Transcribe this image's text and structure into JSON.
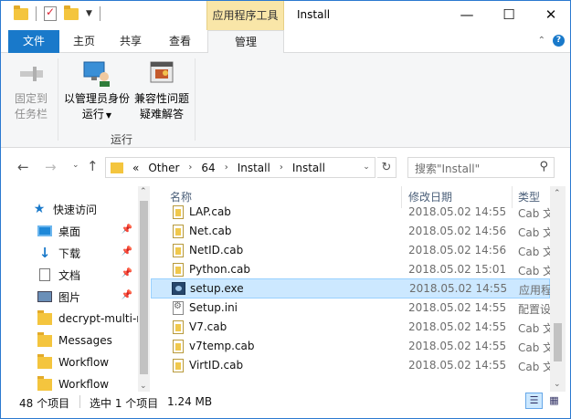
{
  "titlebar": {
    "context_tab_header": "应用程序工具",
    "window_title": "Install",
    "minimize": "—",
    "maximize": "☐",
    "close": "✕"
  },
  "ribbon_tabs": {
    "file": "文件",
    "home": "主页",
    "share": "共享",
    "view": "查看",
    "manage": "管理"
  },
  "ribbon": {
    "pin_line1": "固定到",
    "pin_line2": "任务栏",
    "runas_line1": "以管理员身份",
    "runas_line2": "运行",
    "compat_line1": "兼容性问题",
    "compat_line2": "疑难解答",
    "group_label": "运行"
  },
  "address": {
    "overflow": "«",
    "crumbs": [
      "Other",
      "64",
      "Install",
      "Install"
    ],
    "search_placeholder": "搜索\"Install\""
  },
  "navpane": {
    "items": [
      {
        "label": "快速访问",
        "icon": "star-icon"
      },
      {
        "label": "桌面",
        "icon": "desktop-icon",
        "pinned": true
      },
      {
        "label": "下载",
        "icon": "download-icon",
        "pinned": true
      },
      {
        "label": "文档",
        "icon": "document-icon",
        "pinned": true
      },
      {
        "label": "图片",
        "icon": "pictures-icon",
        "pinned": true
      },
      {
        "label": "decrypt-multi-r",
        "icon": "folder-icon"
      },
      {
        "label": "Messages",
        "icon": "folder-icon"
      },
      {
        "label": "Workflow",
        "icon": "folder-icon"
      },
      {
        "label": "Workflow",
        "icon": "folder-icon"
      }
    ]
  },
  "filelist": {
    "columns": {
      "name": "名称",
      "date": "修改日期",
      "type": "类型"
    },
    "rows": [
      {
        "name": "LAP.cab",
        "date": "2018.05.02 14:55",
        "type": "Cab 文",
        "icon": "cab"
      },
      {
        "name": "Net.cab",
        "date": "2018.05.02 14:56",
        "type": "Cab 文",
        "icon": "cab"
      },
      {
        "name": "NetID.cab",
        "date": "2018.05.02 14:56",
        "type": "Cab 文",
        "icon": "cab"
      },
      {
        "name": "Python.cab",
        "date": "2018.05.02 15:01",
        "type": "Cab 文",
        "icon": "cab"
      },
      {
        "name": "setup.exe",
        "date": "2018.05.02 14:55",
        "type": "应用程",
        "icon": "exe",
        "selected": true
      },
      {
        "name": "Setup.ini",
        "date": "2018.05.02 14:55",
        "type": "配置设",
        "icon": "ini"
      },
      {
        "name": "V7.cab",
        "date": "2018.05.02 14:55",
        "type": "Cab 文",
        "icon": "cab"
      },
      {
        "name": "v7temp.cab",
        "date": "2018.05.02 14:55",
        "type": "Cab 文",
        "icon": "cab"
      },
      {
        "name": "VirtID.cab",
        "date": "2018.05.02 14:55",
        "type": "Cab 文",
        "icon": "cab"
      }
    ]
  },
  "statusbar": {
    "item_count": "48 个项目",
    "selected": "选中 1 个项目",
    "size": "1.24 MB"
  }
}
